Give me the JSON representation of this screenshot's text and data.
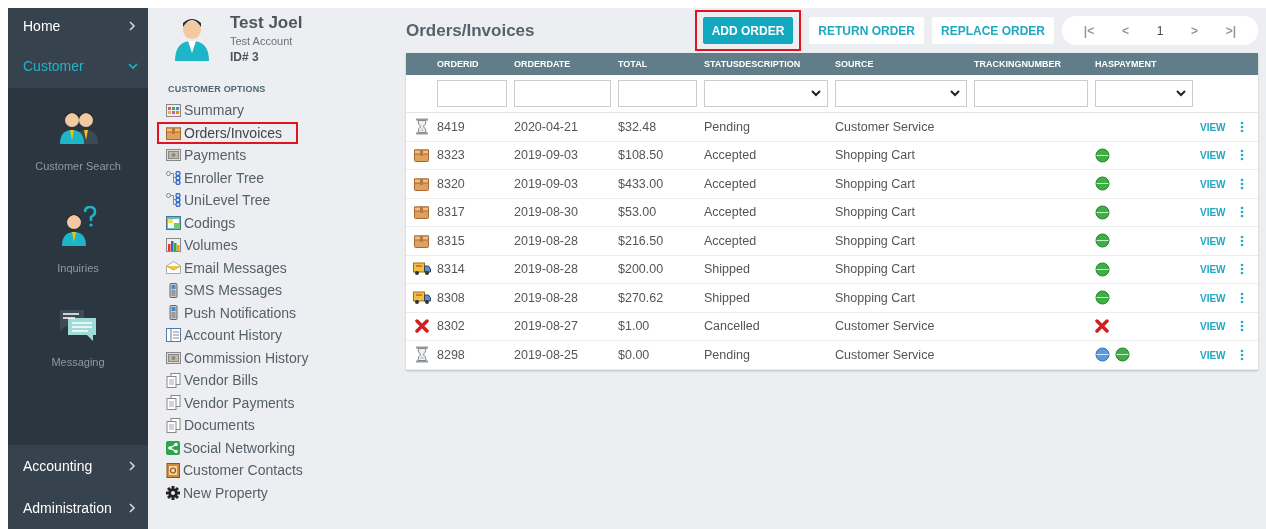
{
  "nav": [
    {
      "label": "Home",
      "expanded": false,
      "selected": false
    },
    {
      "label": "Customer",
      "expanded": true,
      "selected": true,
      "children": [
        {
          "label": "Customer Search",
          "kind": "people"
        },
        {
          "label": "Inquiries",
          "kind": "question"
        },
        {
          "label": "Messaging",
          "kind": "chat"
        }
      ]
    }
  ],
  "nav_bottom": [
    {
      "label": "Accounting",
      "expanded": false
    },
    {
      "label": "Administration",
      "expanded": false
    }
  ],
  "customer": {
    "name": "Test Joel",
    "account": "Test Account",
    "id": "ID# 3"
  },
  "options": {
    "heading": "CUSTOMER OPTIONS",
    "items": [
      {
        "label": "Summary",
        "kind": "grid",
        "selected": false
      },
      {
        "label": "Orders/Invoices",
        "kind": "box",
        "selected": true
      },
      {
        "label": "Payments",
        "kind": "money",
        "selected": false
      },
      {
        "label": "Enroller Tree",
        "kind": "tree",
        "selected": false
      },
      {
        "label": "UniLevel Tree",
        "kind": "tree",
        "selected": false
      },
      {
        "label": "Codings",
        "kind": "table",
        "selected": false
      },
      {
        "label": "Volumes",
        "kind": "chart",
        "selected": false
      },
      {
        "label": "Email Messages",
        "kind": "mail",
        "selected": false
      },
      {
        "label": "SMS Messages",
        "kind": "phone",
        "selected": false
      },
      {
        "label": "Push Notifications",
        "kind": "phone",
        "selected": false
      },
      {
        "label": "Account History",
        "kind": "book",
        "selected": false
      },
      {
        "label": "Commission History",
        "kind": "money",
        "selected": false
      },
      {
        "label": "Vendor Bills",
        "kind": "pages",
        "selected": false
      },
      {
        "label": "Vendor Payments",
        "kind": "pages",
        "selected": false
      },
      {
        "label": "Documents",
        "kind": "pages",
        "selected": false
      },
      {
        "label": "Social Networking",
        "kind": "share",
        "selected": false
      },
      {
        "label": "Customer Contacts",
        "kind": "contacts",
        "selected": false
      },
      {
        "label": "New Property",
        "kind": "gear",
        "selected": false
      }
    ]
  },
  "title": "Orders/Invoices",
  "buttons": [
    {
      "label": "ADD ORDER",
      "kind": "primary",
      "highlighted": true
    },
    {
      "label": "RETURN ORDER",
      "kind": "secondary",
      "highlighted": false
    },
    {
      "label": "REPLACE ORDER",
      "kind": "secondary",
      "highlighted": false
    }
  ],
  "pager": {
    "first": "|<",
    "prev": "<",
    "page": "1",
    "next": ">",
    "last": ">|"
  },
  "table": {
    "columns": [
      {
        "label": "ORDERID",
        "kind": "text"
      },
      {
        "label": "ORDERDATE",
        "kind": "text"
      },
      {
        "label": "TOTAL",
        "kind": "text"
      },
      {
        "label": "STATUSDESCRIPTION",
        "kind": "select"
      },
      {
        "label": "SOURCE",
        "kind": "select"
      },
      {
        "label": "TRACKINGNUMBER",
        "kind": "text"
      },
      {
        "label": "HASPAYMENT",
        "kind": "select"
      }
    ],
    "rows": [
      {
        "kind": "pending",
        "id": "8419",
        "date": "2020-04-21",
        "total": "$32.48",
        "statusText": "Pending",
        "source": "Customer Service",
        "action": "VIEW"
      },
      {
        "kind": "accepted",
        "id": "8323",
        "date": "2019-09-03",
        "total": "$108.50",
        "statusText": "Accepted",
        "source": "Shopping Cart",
        "payments": [
          {
            "kind": "paid"
          }
        ],
        "action": "VIEW"
      },
      {
        "kind": "accepted",
        "id": "8320",
        "date": "2019-09-03",
        "total": "$433.00",
        "statusText": "Accepted",
        "source": "Shopping Cart",
        "payments": [
          {
            "kind": "paid"
          }
        ],
        "action": "VIEW"
      },
      {
        "kind": "accepted",
        "id": "8317",
        "date": "2019-08-30",
        "total": "$53.00",
        "statusText": "Accepted",
        "source": "Shopping Cart",
        "payments": [
          {
            "kind": "paid"
          }
        ],
        "action": "VIEW"
      },
      {
        "kind": "accepted",
        "id": "8315",
        "date": "2019-08-28",
        "total": "$216.50",
        "statusText": "Accepted",
        "source": "Shopping Cart",
        "payments": [
          {
            "kind": "paid"
          }
        ],
        "action": "VIEW"
      },
      {
        "kind": "shipped",
        "id": "8314",
        "date": "2019-08-28",
        "total": "$200.00",
        "statusText": "Shipped",
        "source": "Shopping Cart",
        "payments": [
          {
            "kind": "paid"
          }
        ],
        "action": "VIEW"
      },
      {
        "kind": "shipped",
        "id": "8308",
        "date": "2019-08-28",
        "total": "$270.62",
        "statusText": "Shipped",
        "source": "Shopping Cart",
        "payments": [
          {
            "kind": "paid"
          }
        ],
        "action": "VIEW"
      },
      {
        "kind": "cancelled",
        "id": "8302",
        "date": "2019-08-27",
        "total": "$1.00",
        "statusText": "Cancelled",
        "source": "Customer Service",
        "payments": [
          {
            "kind": "failed"
          }
        ],
        "action": "VIEW"
      },
      {
        "kind": "pending",
        "id": "8298",
        "date": "2019-08-25",
        "total": "$0.00",
        "statusText": "Pending",
        "source": "Customer Service",
        "payments": [
          {
            "kind": "authorized"
          },
          {
            "kind": "paid"
          }
        ],
        "action": "VIEW"
      }
    ]
  }
}
